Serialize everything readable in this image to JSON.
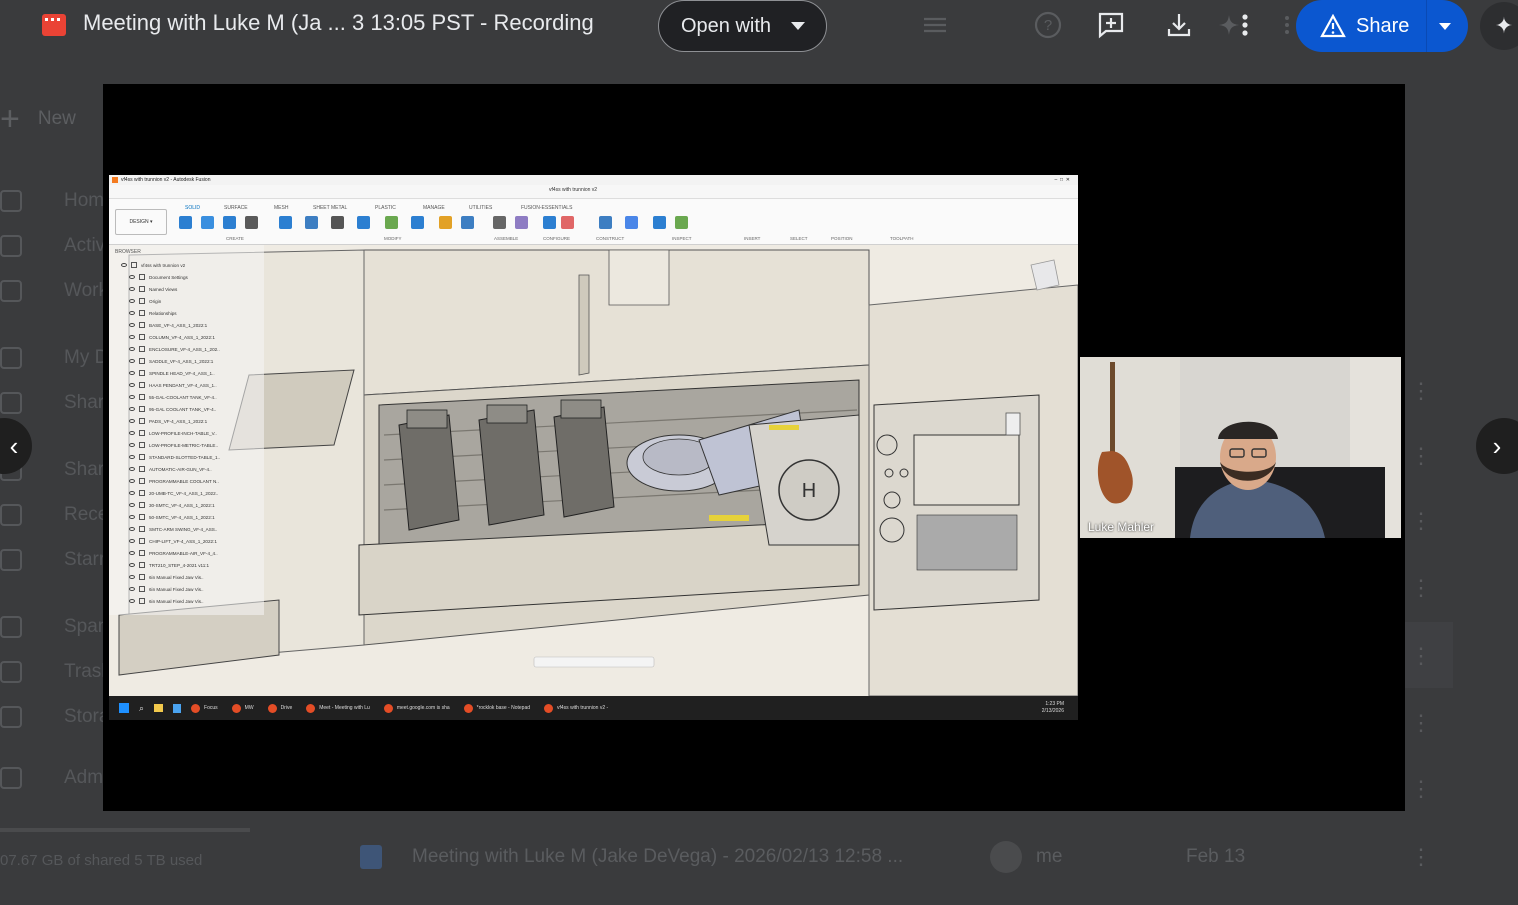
{
  "topbar": {
    "title": "Meeting with Luke M (Ja ... 3 13:05 PST - Recording",
    "open_with": "Open with",
    "share": "Share"
  },
  "drive_bg": {
    "new": "New",
    "nav": [
      "Home",
      "Activity",
      "Workspaces",
      "My Drive",
      "Shared drives",
      "Shared with me",
      "Recent",
      "Starred",
      "Spam",
      "Trash",
      "Storage",
      "Admin console"
    ],
    "storage_text": "07.67 GB of shared 5 TB used",
    "row": {
      "name": "Meeting with Luke M (Jake DeVega) - 2026/02/13 12:58 ...",
      "owner": "me",
      "date": "Feb 13"
    }
  },
  "video": {
    "fusion": {
      "window_title": "vf4ss with trunnion v2 - Autodesk Fusion",
      "doc_tab": "vf4ss with trunnion v2",
      "workspace": "DESIGN",
      "tabs": [
        "SOLID",
        "SURFACE",
        "MESH",
        "SHEET METAL",
        "PLASTIC",
        "MANAGE",
        "UTILITIES",
        "FUSION-ESSENTIALS"
      ],
      "groups": [
        "CREATE",
        "MODIFY",
        "ASSEMBLE",
        "CONFIGURE",
        "CONSTRUCT",
        "INSPECT",
        "INSERT",
        "SELECT",
        "POSITION",
        "TOOLPATH"
      ],
      "browser_title": "BROWSER",
      "root_component": "vf4ss with trunnion v2",
      "browser_items": [
        "Document Settings",
        "Named Views",
        "Origin",
        "Relationships",
        "BASE_VF-4_ASS_1_2022:1",
        "COLUMN_VF-4_ASS_1_2022:1",
        "ENCLOSURE_VF-4_ASS_1_202..",
        "SADDLE_VF-4_ASS_1_2022:1",
        "SPINDLE HEAD_VF-4_ASS_1..",
        "HAAS PENDANT_VF-4_ASS_1..",
        "55-GAL-COOLANT TANK_VF-4..",
        "95-GAL COOLANT TANK_VF-4..",
        "PADS_VF-4_ASS_1_2022:1",
        "LOW-PROFILE-INCH-TABLE_V..",
        "LOW-PROFILE-METRIC-TABLE..",
        "STANDARD-SLOTTED-TABLE_1..",
        "AUTOMATIC-AIR-GUN_VF-4..",
        "PROGRAMMABLE COOLANT N..",
        "20-UMB-TC_VF-4_ASS_1_2022..",
        "30-SMTC_VF-4_ASS_1_2022:1",
        "50-SMTC_VF-4_ASS_1_2022:1",
        "SMTC-ARM SWING_VF-4_ASS..",
        "CHIP-LIFT_VF-4_ASS_1_2022:1",
        "PROGRAMMABLE-AIR_VF-4_4..",
        "TRT210_STEP_4-2021 v11:1",
        "6in Manual Fixed Jaw Vis..",
        "6in Manual Fixed Jaw Vis..",
        "6in Manual Fixed Jaw Vis.."
      ]
    },
    "taskbar": {
      "apps": [
        "Focus",
        "MW",
        "Drive",
        "Meet - Meeting with Lu",
        "meet.google.com is sha",
        "*rocklok base - Notepad",
        "vf4ss with trunnion v2 -"
      ],
      "time": "1:23 PM",
      "date": "2/13/2026"
    },
    "participant_name": "Luke Mahler"
  }
}
